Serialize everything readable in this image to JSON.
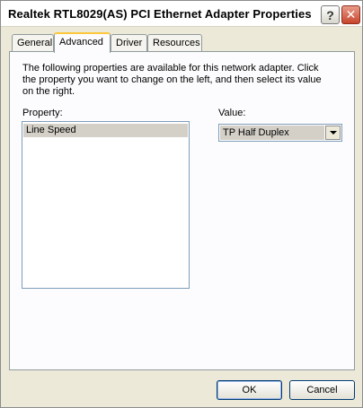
{
  "window": {
    "title": "Realtek RTL8029(AS) PCI Ethernet Adapter Properties",
    "help_label": "?",
    "close_label": "✕"
  },
  "tabs": [
    {
      "label": "General",
      "active": false
    },
    {
      "label": "Advanced",
      "active": true
    },
    {
      "label": "Driver",
      "active": false
    },
    {
      "label": "Resources",
      "active": false
    }
  ],
  "advanced": {
    "description": "The following properties are available for this network adapter. Click the property you want to change on the left, and then select its value on the right.",
    "property_label": "Property:",
    "value_label": "Value:",
    "properties": [
      "Line Speed"
    ],
    "selected_value": "TP Half Duplex"
  },
  "buttons": {
    "ok": "OK",
    "cancel": "Cancel"
  }
}
